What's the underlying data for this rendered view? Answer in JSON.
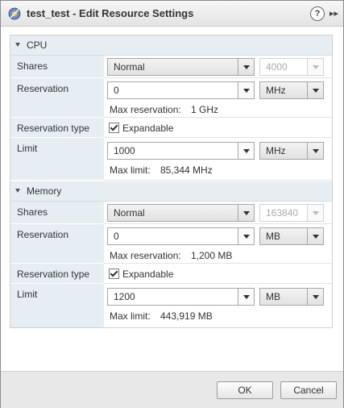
{
  "window": {
    "title": "test_test - Edit Resource Settings",
    "help": "?",
    "expand": "▸▸"
  },
  "cpu": {
    "section_label": "CPU",
    "shares": {
      "label": "Shares",
      "level": "Normal",
      "value": "4000"
    },
    "reservation": {
      "label": "Reservation",
      "value": "0",
      "unit": "MHz",
      "max_label": "Max reservation:",
      "max_value": "1 GHz"
    },
    "reservation_type": {
      "label": "Reservation type",
      "option": "Expandable",
      "checked": true
    },
    "limit": {
      "label": "Limit",
      "value": "1000",
      "unit": "MHz",
      "max_label": "Max limit:",
      "max_value": "85,344 MHz"
    }
  },
  "memory": {
    "section_label": "Memory",
    "shares": {
      "label": "Shares",
      "level": "Normal",
      "value": "163840"
    },
    "reservation": {
      "label": "Reservation",
      "value": "0",
      "unit": "MB",
      "max_label": "Max reservation:",
      "max_value": "1,200 MB"
    },
    "reservation_type": {
      "label": "Reservation type",
      "option": "Expandable",
      "checked": true
    },
    "limit": {
      "label": "Limit",
      "value": "1200",
      "unit": "MB",
      "max_label": "Max limit:",
      "max_value": "443,919 MB"
    }
  },
  "footer": {
    "ok": "OK",
    "cancel": "Cancel"
  }
}
